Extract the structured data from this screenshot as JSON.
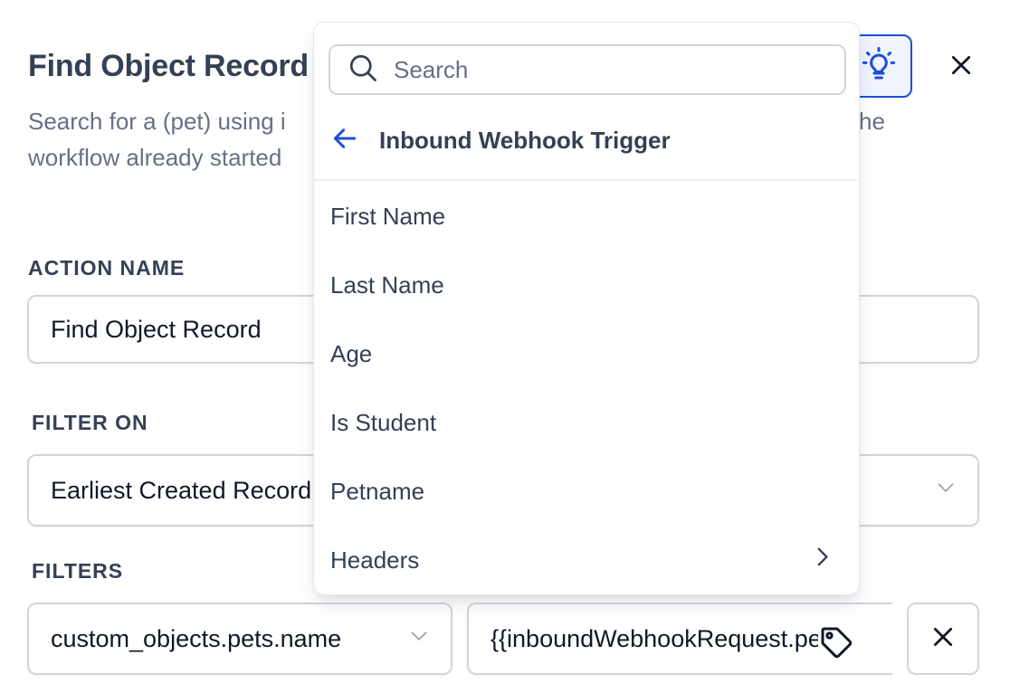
{
  "panel": {
    "title": "Find Object Record",
    "description_line1": "Search for a (pet) using i",
    "description_line1_tail": "he",
    "description_line2": "workflow already started"
  },
  "action_name": {
    "label": "ACTION NAME",
    "value": "Find Object Record"
  },
  "filter_on": {
    "label": "FILTER ON",
    "value": "Earliest Created Record"
  },
  "filters": {
    "label": "FILTERS",
    "field_value": "custom_objects.pets.name",
    "value_input": "{{inboundWebhookRequest.petname}}"
  },
  "dropdown": {
    "search_placeholder": "Search",
    "back_label": "Inbound Webhook Trigger",
    "items": [
      {
        "label": "First Name",
        "has_submenu": false
      },
      {
        "label": "Last Name",
        "has_submenu": false
      },
      {
        "label": "Age",
        "has_submenu": false
      },
      {
        "label": "Is Student",
        "has_submenu": false
      },
      {
        "label": "Petname",
        "has_submenu": false
      },
      {
        "label": "Headers",
        "has_submenu": true
      }
    ]
  },
  "icons": {
    "bulb": "lightbulb-icon",
    "close": "close-icon",
    "search": "search-icon",
    "back": "arrow-left-icon",
    "chevron_right": "chevron-right-icon",
    "chevron_down": "chevron-down-icon",
    "tag": "tag-icon"
  },
  "colors": {
    "accent": "#1d4ed8",
    "text_primary": "#344054",
    "text_secondary": "#667085",
    "border": "#d0d5dd"
  }
}
